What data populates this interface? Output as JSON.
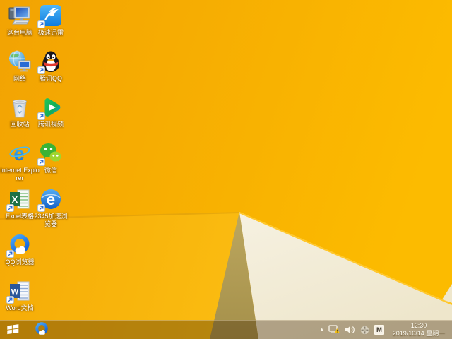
{
  "desktop": {
    "icons": [
      {
        "label": "这台电脑",
        "icon": "this-pc",
        "shortcut": false
      },
      {
        "label": "极速迅雷",
        "icon": "thunder",
        "shortcut": true
      },
      {
        "label": "网络",
        "icon": "network",
        "shortcut": false
      },
      {
        "label": "腾讯QQ",
        "icon": "tencent-qq",
        "shortcut": true
      },
      {
        "label": "回收站",
        "icon": "recycle-bin",
        "shortcut": false
      },
      {
        "label": "腾讯视频",
        "icon": "tencent-video",
        "shortcut": true
      },
      {
        "label": "Internet Explorer",
        "icon": "internet-explorer",
        "shortcut": false
      },
      {
        "label": "微信",
        "icon": "wechat",
        "shortcut": true
      },
      {
        "label": "Excel表格",
        "icon": "excel",
        "shortcut": true
      },
      {
        "label": "2345加速浏览器",
        "icon": "2345-browser",
        "shortcut": true
      },
      {
        "label": "QQ浏览器",
        "icon": "qq-browser",
        "shortcut": true
      },
      {
        "label": "Word文档",
        "icon": "word",
        "shortcut": true
      }
    ]
  },
  "taskbar": {
    "tray": {
      "ime_indicator": "M",
      "time": "12:30",
      "date": "2019/10/14 星期一"
    }
  },
  "colors": {
    "wallpaper_orange": "#F3A403",
    "wallpaper_yellow": "#FCBB00",
    "fold_cream": "#F4EFDC",
    "fold_tan": "#B4A058",
    "fold_highlight": "#FFC82E",
    "taskbar_tint": "rgba(72,46,10,0.38)"
  }
}
